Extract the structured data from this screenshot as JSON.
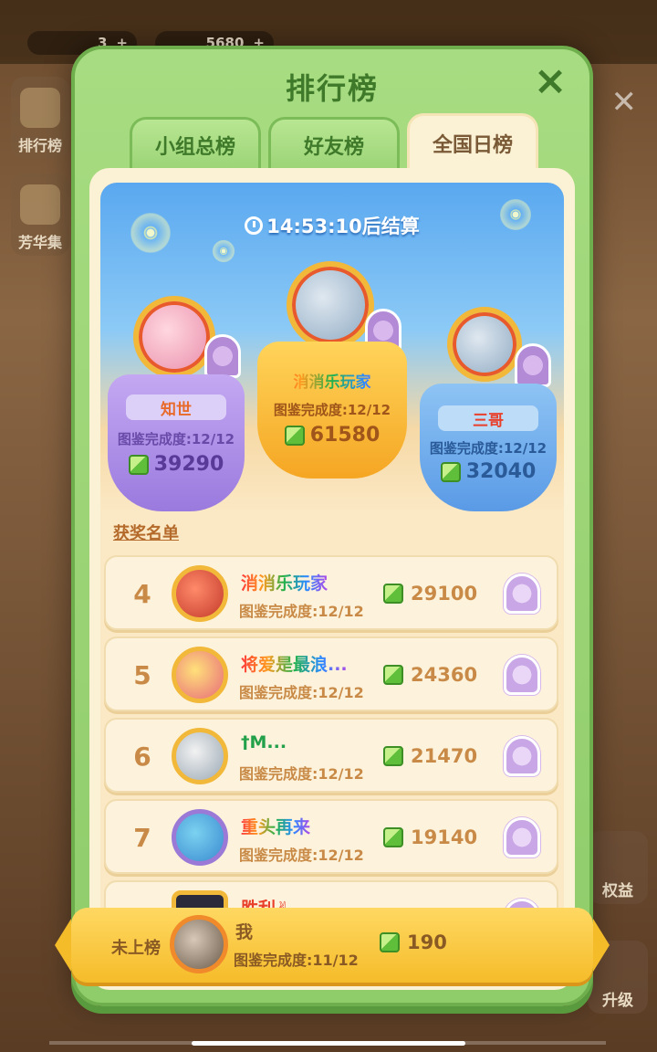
{
  "background": {
    "resources": [
      {
        "value": "3"
      },
      {
        "value": "5680"
      }
    ],
    "left_buttons": [
      {
        "label": "排行榜"
      },
      {
        "label": "芳华集"
      }
    ],
    "right_buttons": [
      {
        "label": "权益"
      },
      {
        "label": "升级"
      }
    ]
  },
  "panel": {
    "title": "排行榜",
    "close_icon": "×",
    "tabs": [
      {
        "label": "小组总榜",
        "active": false
      },
      {
        "label": "好友榜",
        "active": false
      },
      {
        "label": "全国日榜",
        "active": true
      }
    ],
    "timer": "14:53:10后结算"
  },
  "podium": {
    "first": {
      "name": "消消乐玩家",
      "progress": "图鉴完成度:12/12",
      "score": "61580"
    },
    "second": {
      "name": "知世",
      "progress": "图鉴完成度:12/12",
      "score": "39290"
    },
    "third": {
      "name": "三哥",
      "progress": "图鉴完成度:12/12",
      "score": "32040"
    }
  },
  "section_title": "获奖名单",
  "list": [
    {
      "rank": "4",
      "name": "消消乐玩家",
      "progress": "图鉴完成度:12/12",
      "score": "29100"
    },
    {
      "rank": "5",
      "name": "将爱是最浪...",
      "progress": "图鉴完成度:12/12",
      "score": "24360"
    },
    {
      "rank": "6",
      "name": "†M...",
      "progress": "图鉴完成度:12/12",
      "score": "21470"
    },
    {
      "rank": "7",
      "name": "重头再来",
      "progress": "图鉴完成度:12/12",
      "score": "19140"
    },
    {
      "rank": "",
      "name": "胜利✌",
      "progress": "",
      "score": ""
    }
  ],
  "me": {
    "status": "未上榜",
    "name": "我",
    "progress": "图鉴完成度:11/12",
    "score": "190"
  },
  "colors": {
    "accent_green": "#8fcc6a",
    "gold": "#f5bc2a",
    "text_brown": "#c88a46"
  }
}
